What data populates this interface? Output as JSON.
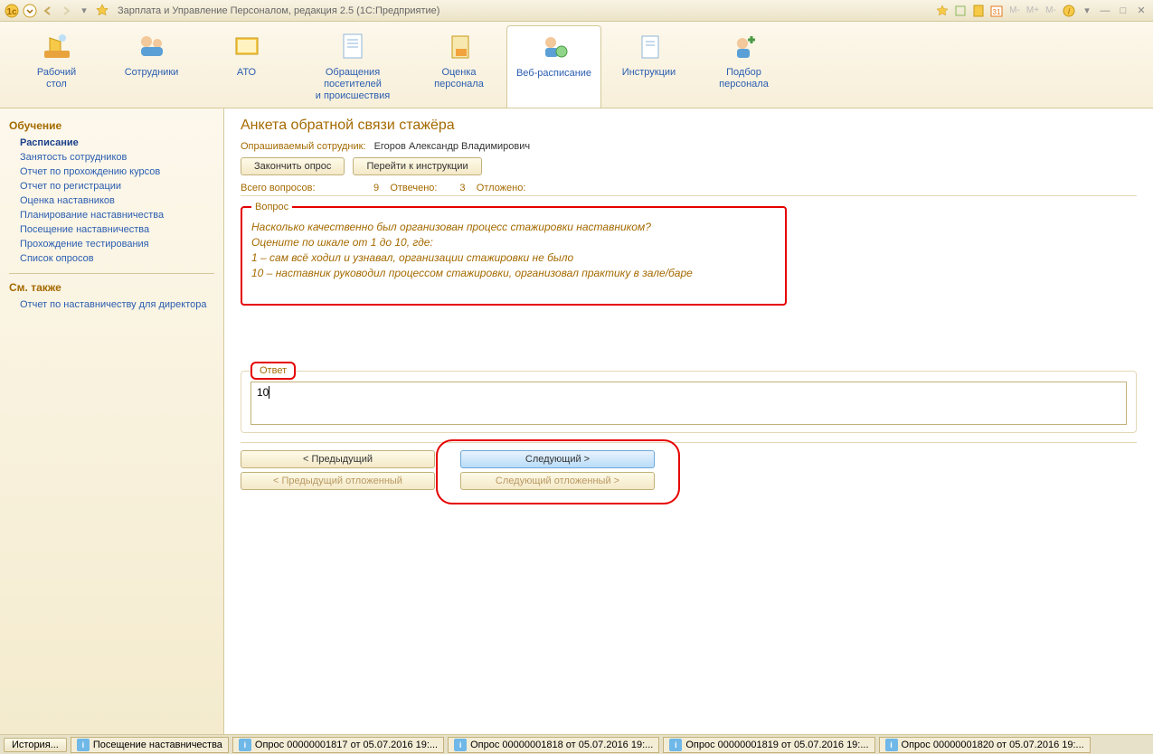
{
  "titlebar": {
    "title": "Зарплата и Управление Персоналом, редакция 2.5  (1С:Предприятие)",
    "m_labels": [
      "M-",
      "M+",
      "M-"
    ]
  },
  "ribbon": [
    {
      "label": "Рабочий\nстол"
    },
    {
      "label": "Сотрудники"
    },
    {
      "label": "АТО"
    },
    {
      "label": "Обращения посетителей\nи происшествия"
    },
    {
      "label": "Оценка\nперсонала"
    },
    {
      "label": "Веб-расписание"
    },
    {
      "label": "Инструкции"
    },
    {
      "label": "Подбор\nперсонала"
    }
  ],
  "sidebar": {
    "heading1": "Обучение",
    "links1": [
      "Расписание",
      "Занятость сотрудников",
      "Отчет по прохождению курсов",
      "Отчет по регистрации",
      "Оценка наставников",
      "Планирование наставничества",
      "Посещение наставничества",
      "Прохождение тестирования",
      "Список опросов"
    ],
    "heading2": "См. также",
    "links2": [
      "Отчет по наставничеству для директора"
    ]
  },
  "page": {
    "title": "Анкета обратной связи стажёра",
    "interviewee_label": "Опрашиваемый сотрудник:",
    "interviewee_value": "Егоров Александр Владимирович",
    "finish_btn": "Закончить опрос",
    "goto_btn": "Перейти к инструкции",
    "stats": {
      "total_label": "Всего вопросов:",
      "total_value": "9",
      "answered_label": "Отвечено:",
      "answered_value": "3",
      "deferred_label": "Отложено:",
      "deferred_value": ""
    },
    "question_legend": "Вопрос",
    "question_lines": [
      "Насколько качественно был организован процесс стажировки наставником?",
      "Оцените по шкале от 1 до 10, где:",
      "1 – сам всё ходил и узнавал, организации стажировки не было",
      "10 – наставник руководил процессом стажировки, организовал практику в зале/баре"
    ],
    "answer_legend": "Ответ",
    "answer_value": "10",
    "nav": {
      "prev": "< Предыдущий",
      "next": "Следующий >",
      "prev_def": "< Предыдущий отложенный",
      "next_def": "Следующий отложенный >"
    }
  },
  "statusbar": {
    "history": "История...",
    "tabs": [
      "Посещение наставничества",
      "Опрос 00000001817 от 05.07.2016 19:...",
      "Опрос 00000001818 от 05.07.2016 19:...",
      "Опрос 00000001819 от 05.07.2016 19:...",
      "Опрос 00000001820 от 05.07.2016 19:..."
    ]
  }
}
